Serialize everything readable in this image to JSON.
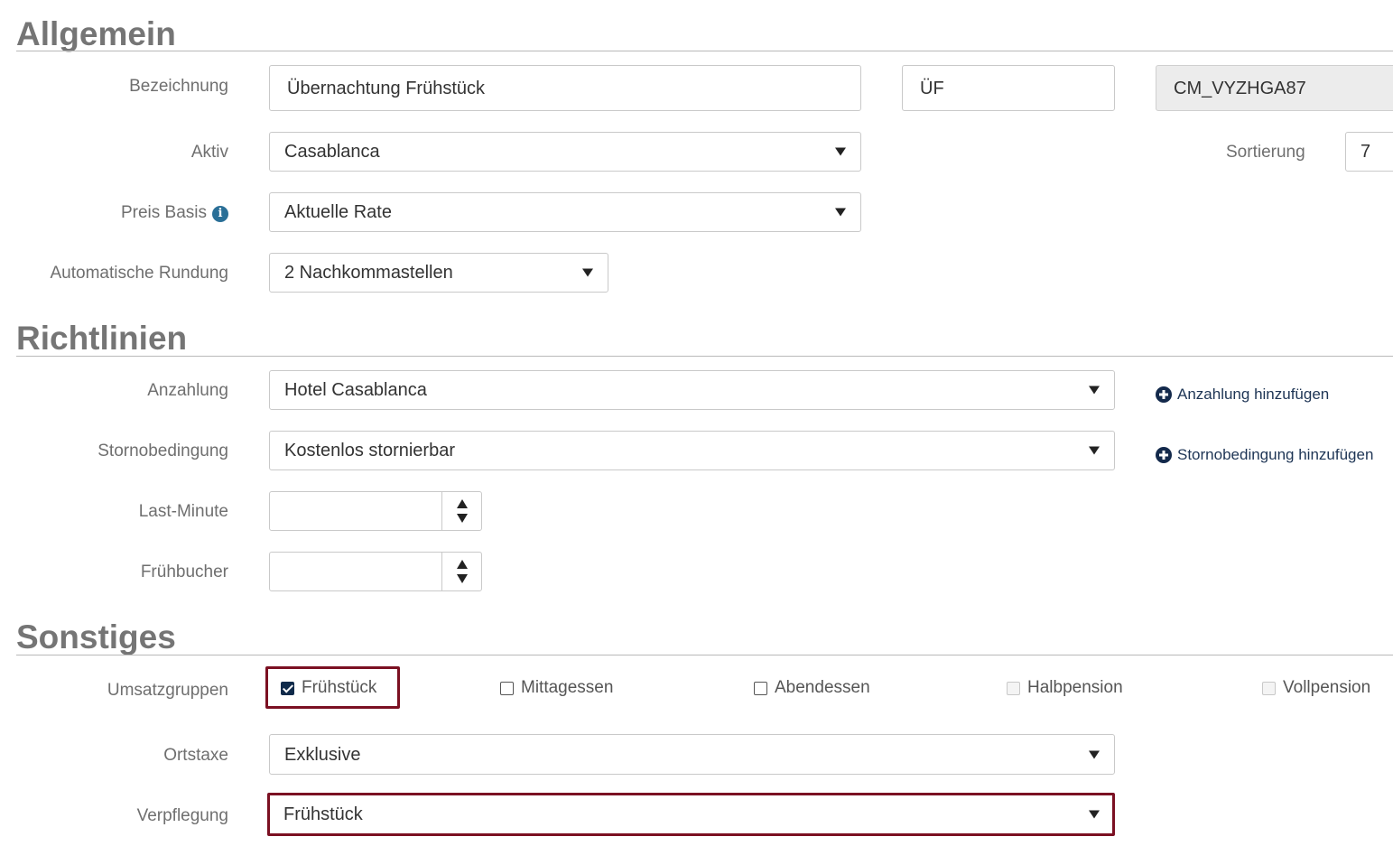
{
  "allgemein": {
    "title": "Allgemein",
    "bezeichnung": {
      "label": "Bezeichnung",
      "name": "Übernachtung Frühstück",
      "short": "ÜF",
      "code": "CM_VYZHGA87"
    },
    "aktiv": {
      "label": "Aktiv",
      "value": "Casablanca"
    },
    "sortierung": {
      "label": "Sortierung",
      "value": "7"
    },
    "preis_basis": {
      "label": "Preis Basis",
      "value": "Aktuelle Rate",
      "info_icon": "info-icon"
    },
    "rundung": {
      "label": "Automatische Rundung",
      "value": "2 Nachkommastellen"
    }
  },
  "richtlinien": {
    "title": "Richtlinien",
    "anzahlung": {
      "label": "Anzahlung",
      "value": "Hotel Casablanca",
      "add_label": "Anzahlung hinzufügen"
    },
    "storno": {
      "label": "Stornobedingung",
      "value": "Kostenlos stornierbar",
      "add_label": "Stornobedingung hinzufügen"
    },
    "last_minute": {
      "label": "Last-Minute",
      "value": ""
    },
    "fruehbucher": {
      "label": "Frühbucher",
      "value": ""
    }
  },
  "sonstiges": {
    "title": "Sonstiges",
    "umsatzgruppen": {
      "label": "Umsatzgruppen",
      "options": [
        {
          "label": "Frühstück",
          "checked": true,
          "disabled": false
        },
        {
          "label": "Mittagessen",
          "checked": false,
          "disabled": false
        },
        {
          "label": "Abendessen",
          "checked": false,
          "disabled": false
        },
        {
          "label": "Halbpension",
          "checked": false,
          "disabled": true
        },
        {
          "label": "Vollpension",
          "checked": false,
          "disabled": true
        }
      ]
    },
    "ortstaxe": {
      "label": "Ortstaxe",
      "value": "Exklusive"
    },
    "verpflegung": {
      "label": "Verpflegung",
      "value": "Frühstück"
    }
  },
  "colors": {
    "highlight": "#7b1022",
    "link": "#1e3555",
    "title": "#757575"
  }
}
